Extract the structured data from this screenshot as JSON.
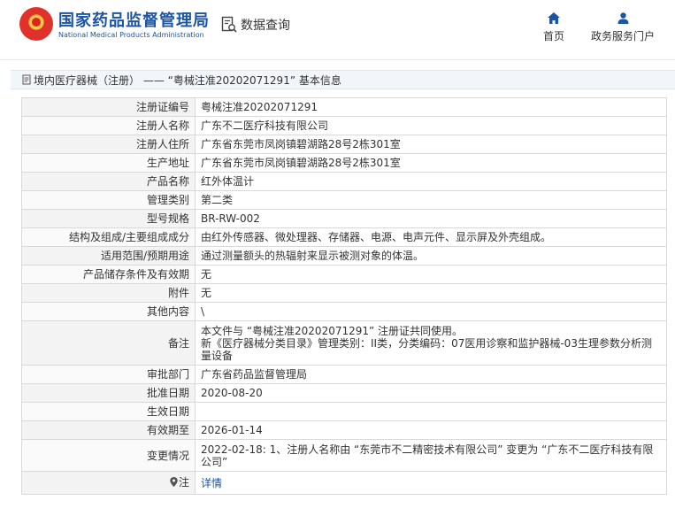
{
  "header": {
    "site_name_cn": "国家药品监督管理局",
    "site_name_en": "National Medical Products Administration",
    "data_query_label": "数据查询",
    "nav": [
      {
        "label": "首页",
        "icon": "home-icon"
      },
      {
        "label": "政务服务门户",
        "icon": "user-icon"
      }
    ]
  },
  "title_bar": {
    "text": "境内医疗器械（注册） ——  “粤械注准20202071291” 基本信息"
  },
  "rows": [
    {
      "label": "注册证编号",
      "value": "粤械注准20202071291"
    },
    {
      "label": "注册人名称",
      "value": "广东不二医疗科技有限公司"
    },
    {
      "label": "注册人住所",
      "value": "广东省东莞市凤岗镇碧湖路28号2栋301室"
    },
    {
      "label": "生产地址",
      "value": "广东省东莞市凤岗镇碧湖路28号2栋301室"
    },
    {
      "label": "产品名称",
      "value": "红外体温计"
    },
    {
      "label": "管理类别",
      "value": "第二类"
    },
    {
      "label": "型号规格",
      "value": "BR-RW-002"
    },
    {
      "label": "结构及组成/主要组成成分",
      "value": "由红外传感器、微处理器、存储器、电源、电声元件、显示屏及外壳组成。"
    },
    {
      "label": "适用范围/预期用途",
      "value": "通过测量额头的热辐射来显示被测对象的体温。"
    },
    {
      "label": "产品储存条件及有效期",
      "value": "无"
    },
    {
      "label": "附件",
      "value": "无"
    },
    {
      "label": "其他内容",
      "value": "\\"
    },
    {
      "label": "备注",
      "value_lines": [
        "本文件与 “粤械注准20202071291” 注册证共同使用。",
        "新《医疗器械分类目录》管理类别：II类，分类编码：07医用诊察和监护器械-03生理参数分析测量设备"
      ]
    },
    {
      "label": "审批部门",
      "value": "广东省药品监督管理局"
    },
    {
      "label": "批准日期",
      "value": "2020-08-20"
    },
    {
      "label": "生效日期",
      "value": ""
    },
    {
      "label": "有效期至",
      "value": "2026-01-14"
    },
    {
      "label": "变更情况",
      "value": "2022-02-18: 1、注册人名称由 “东莞市不二精密技术有限公司” 变更为 “广东不二医疗科技有限公司”"
    },
    {
      "label": "注",
      "value": "详情",
      "icon": "location-pin-icon"
    }
  ]
}
